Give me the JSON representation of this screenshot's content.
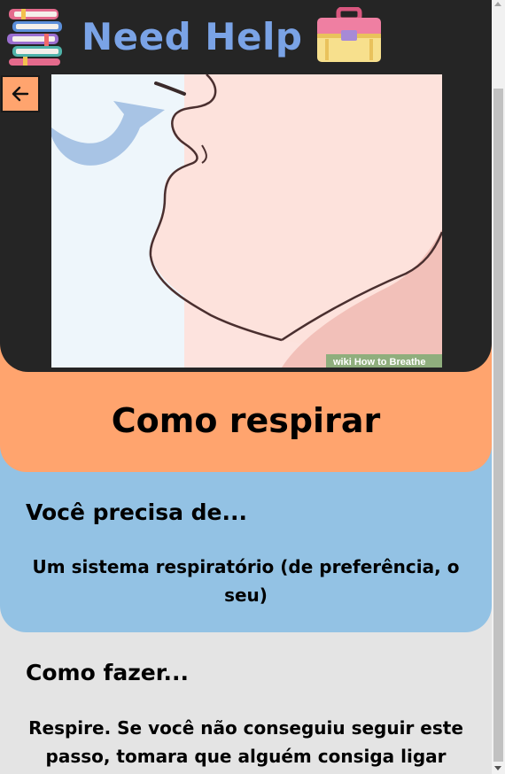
{
  "app": {
    "title": "Need Help"
  },
  "header": {
    "back_button_icon": "arrow-left-icon",
    "illustration_watermark": "wiki How to Breathe"
  },
  "page": {
    "title": "Como respirar"
  },
  "needs": {
    "heading": "Você precisa de...",
    "text": "Um sistema respiratório (de preferência, o seu)"
  },
  "how": {
    "heading": "Como fazer...",
    "text": "Respire. Se você não conseguiu seguir este passo, tomara que alguém consiga ligar pro SAMU."
  },
  "colors": {
    "header_bg": "#252525",
    "brand_text": "#7aa3e6",
    "accent_orange": "#ffa46e",
    "section_blue": "#93c2e4",
    "page_bg": "#e4e4e4"
  },
  "icons": {
    "left_logo": "stacked-books-icon",
    "right_logo": "toolbox-icon"
  }
}
